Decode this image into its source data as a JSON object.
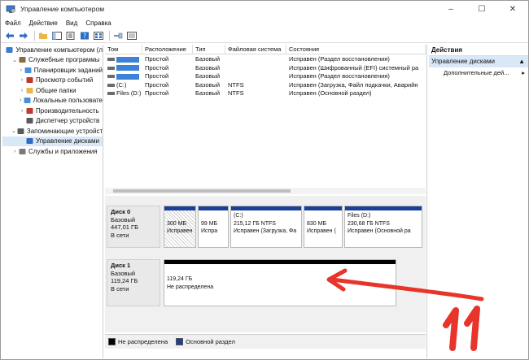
{
  "window": {
    "title": "Управление компьютером",
    "controls": [
      "–",
      "☐",
      "✕"
    ]
  },
  "menu": [
    "Файл",
    "Действие",
    "Вид",
    "Справка"
  ],
  "tree": [
    {
      "label": "Управление компьютером (л",
      "level": 0,
      "chevron": "",
      "icon": "computer-mgmt-icon"
    },
    {
      "label": "Служебные программы",
      "level": 1,
      "chevron": "v",
      "icon": "tools-icon"
    },
    {
      "label": "Планировщик заданий",
      "level": 2,
      "chevron": ">",
      "icon": "clock-icon"
    },
    {
      "label": "Просмотр событий",
      "level": 2,
      "chevron": ">",
      "icon": "event-viewer-icon"
    },
    {
      "label": "Общие папки",
      "level": 2,
      "chevron": ">",
      "icon": "shared-folder-icon"
    },
    {
      "label": "Локальные пользовате",
      "level": 2,
      "chevron": ">",
      "icon": "users-icon"
    },
    {
      "label": "Производительность",
      "level": 2,
      "chevron": ">",
      "icon": "performance-icon"
    },
    {
      "label": "Диспетчер устройств",
      "level": 2,
      "chevron": "",
      "icon": "device-manager-icon"
    },
    {
      "label": "Запоминающие устройст",
      "level": 1,
      "chevron": "v",
      "icon": "storage-icon"
    },
    {
      "label": "Управление дисками",
      "level": 2,
      "chevron": "",
      "icon": "disk-mgmt-icon",
      "selected": true
    },
    {
      "label": "Службы и приложения",
      "level": 1,
      "chevron": ">",
      "icon": "services-icon"
    }
  ],
  "volumes": {
    "headers": [
      "Том",
      "Расположение",
      "Тип",
      "Файловая система",
      "Состояние"
    ],
    "rows": [
      [
        "",
        "Простой",
        "Базовый",
        "",
        "Исправен (Раздел восстановления)"
      ],
      [
        "",
        "Простой",
        "Базовый",
        "",
        "Исправен (Шифрованный (EFI) системный ра"
      ],
      [
        "",
        "Простой",
        "Базовый",
        "",
        "Исправен (Раздел восстановления)"
      ],
      [
        "(C:)",
        "Простой",
        "Базовый",
        "NTFS",
        "Исправен (Загрузка, Файл подкачки, Аварийн"
      ],
      [
        "Files (D:)",
        "Простой",
        "Базовый",
        "NTFS",
        "Исправен (Основной раздел)"
      ]
    ]
  },
  "disks": [
    {
      "name": "Диск 0",
      "type": "Базовый",
      "size": "447,01 ГБ",
      "status": "В сети",
      "partitions": [
        {
          "title": "",
          "size": "300 МБ",
          "state": "Исправен",
          "style": "hatched"
        },
        {
          "title": "",
          "size": "99 МБ",
          "state": "Испра",
          "style": "primary"
        },
        {
          "title": "(C:)",
          "size": "215,12 ГБ NTFS",
          "state": "Исправен (Загрузка, Фа",
          "style": "primary"
        },
        {
          "title": "",
          "size": "830 МБ",
          "state": "Исправен (",
          "style": "primary"
        },
        {
          "title": "Files  (D:)",
          "size": "230,68 ГБ NTFS",
          "state": "Исправен (Основной ра",
          "style": "primary"
        }
      ]
    },
    {
      "name": "Диск 1",
      "type": "Базовый",
      "size": "119,24 ГБ",
      "status": "В сети",
      "partitions": [
        {
          "title": "",
          "size": "119,24 ГБ",
          "state": "Не распределена",
          "style": "unallocated"
        }
      ]
    }
  ],
  "legend": [
    {
      "label": "Не распределена",
      "color": "#000000"
    },
    {
      "label": "Основной раздел",
      "color": "#1b3f96"
    }
  ],
  "actions": {
    "title": "Действия",
    "section": "Управление дисками",
    "items": [
      "Дополнительные дей..."
    ]
  },
  "colors": {
    "accent": "#1b3f96",
    "selection": "#d9e8f7",
    "annotation": "#e8352b"
  }
}
